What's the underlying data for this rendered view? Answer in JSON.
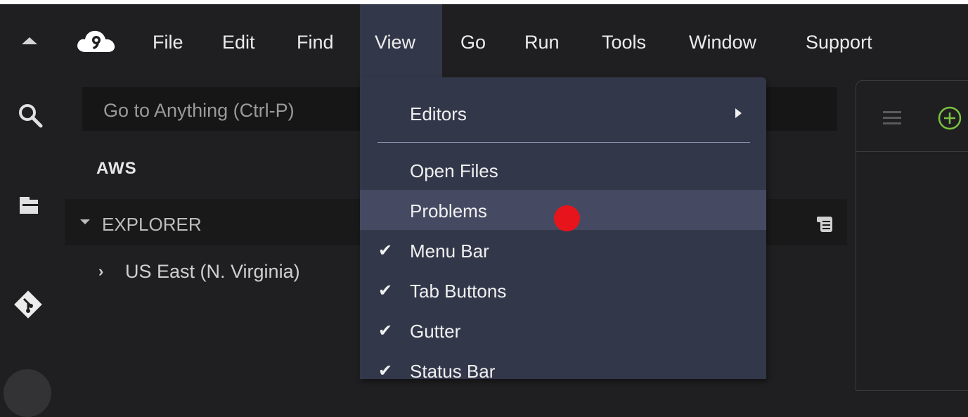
{
  "menubar": {
    "items": [
      "File",
      "Edit",
      "Find",
      "View",
      "Go",
      "Run",
      "Tools",
      "Window",
      "Support"
    ],
    "active": "View"
  },
  "search": {
    "placeholder": "Go to Anything (Ctrl-P)"
  },
  "sidebar": {
    "section_title": "AWS",
    "explorer_label": "EXPLORER",
    "tree": [
      {
        "label": "US East (N. Virginia)",
        "expanded": false
      }
    ]
  },
  "view_menu": {
    "items": [
      {
        "label": "Editors",
        "submenu": true
      },
      {
        "label": "Open Files",
        "checked": false
      },
      {
        "label": "Problems",
        "checked": false,
        "hovered": true
      },
      {
        "label": "Menu Bar",
        "checked": true
      },
      {
        "label": "Tab Buttons",
        "checked": true
      },
      {
        "label": "Gutter",
        "checked": true
      },
      {
        "label": "Status Bar",
        "checked": true
      }
    ],
    "check_glyph": "✔"
  },
  "icons": {
    "logo": "cloud9-logo-icon",
    "collapse": "caret-up-icon",
    "search": "search-icon",
    "files": "folder-icon",
    "git": "git-icon",
    "explorer_menu": "scroll-menu-icon",
    "panel_menu": "hamburger-icon",
    "add": "plus-circle-icon"
  },
  "colors": {
    "background": "#1f1f21",
    "menu_background": "#33374a",
    "menu_hover": "#454a62",
    "accent_green": "#7ac23f",
    "cursor_marker": "#e8141b"
  }
}
